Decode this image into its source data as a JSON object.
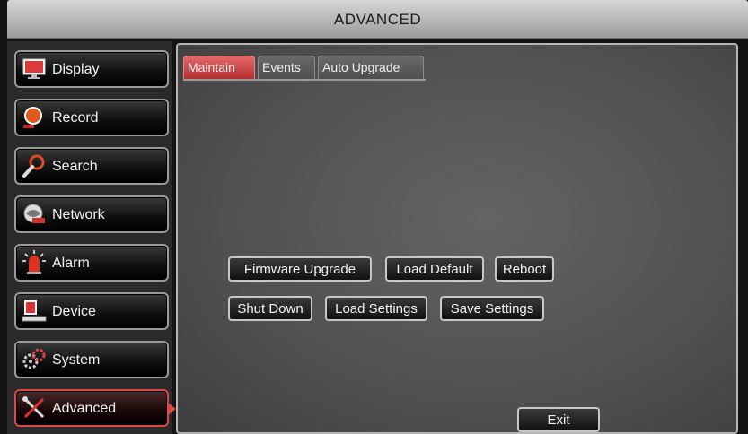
{
  "window": {
    "title": "ADVANCED"
  },
  "sidebar": {
    "items": [
      {
        "label": "Display",
        "icon": "monitor-icon"
      },
      {
        "label": "Record",
        "icon": "record-icon"
      },
      {
        "label": "Search",
        "icon": "magnifier-icon"
      },
      {
        "label": "Network",
        "icon": "network-icon"
      },
      {
        "label": "Alarm",
        "icon": "alarm-icon"
      },
      {
        "label": "Device",
        "icon": "device-icon"
      },
      {
        "label": "System",
        "icon": "system-icon"
      },
      {
        "label": "Advanced",
        "icon": "tools-icon"
      }
    ],
    "active": "Advanced"
  },
  "tabs": {
    "items": [
      "Maintain",
      "Events",
      "Auto Upgrade"
    ],
    "active": "Maintain"
  },
  "maintain": {
    "firmware_upgrade": "Firmware Upgrade",
    "load_default": "Load Default",
    "reboot": "Reboot",
    "shut_down": "Shut Down",
    "load_settings": "Load Settings",
    "save_settings": "Save Settings"
  },
  "footer": {
    "exit": "Exit"
  },
  "colors": {
    "accent": "#c83a3a",
    "panel": "#555555"
  }
}
